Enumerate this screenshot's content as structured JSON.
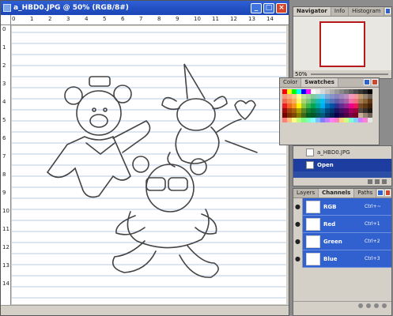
{
  "document": {
    "title": "a_HBD0.JPG @ 50% (RGB/8#)",
    "ruler_top": [
      "0",
      "1",
      "2",
      "3",
      "4",
      "5",
      "6",
      "7",
      "8",
      "9",
      "10",
      "11",
      "12",
      "13",
      "14"
    ],
    "ruler_left": [
      "0",
      "1",
      "2",
      "3",
      "4",
      "5",
      "6",
      "7",
      "8",
      "9",
      "10",
      "11",
      "12",
      "13",
      "14"
    ]
  },
  "navigator": {
    "tabs": [
      "Navigator",
      "Info",
      "Histogram"
    ],
    "zoom": "50%"
  },
  "swatches": {
    "tabs": [
      "Color",
      "Swatches"
    ],
    "colors": [
      "#ff0000",
      "#ffff00",
      "#00ff00",
      "#00ffff",
      "#0000ff",
      "#ff00ff",
      "#ffffff",
      "#ebebeb",
      "#d7d7d7",
      "#c3c3c3",
      "#afafaf",
      "#9b9b9b",
      "#878787",
      "#737373",
      "#5f5f5f",
      "#4b4b4b",
      "#373737",
      "#232323",
      "#000000",
      "#f7977a",
      "#f9ad81",
      "#fdc68a",
      "#fff79a",
      "#c4df9b",
      "#a2d39c",
      "#82ca9d",
      "#7bcdc8",
      "#6ecff6",
      "#7ea7d8",
      "#8493ca",
      "#8882be",
      "#a187be",
      "#bc8dbf",
      "#f49ac2",
      "#f6989d",
      "#c69c6d",
      "#998675",
      "#736357",
      "#f26c4f",
      "#f68e56",
      "#fbaf5d",
      "#fff467",
      "#acd372",
      "#7cc576",
      "#3bb878",
      "#1abbb4",
      "#00bff3",
      "#438ccb",
      "#5574b9",
      "#605ca8",
      "#855fa8",
      "#a763a8",
      "#f06ea9",
      "#f26d7d",
      "#a67c52",
      "#8c6239",
      "#603913",
      "#ed1c24",
      "#f26522",
      "#f7941d",
      "#fff200",
      "#8dc63f",
      "#39b54a",
      "#00a651",
      "#00a99d",
      "#00aeef",
      "#0072bc",
      "#0054a6",
      "#2e3192",
      "#662d91",
      "#92278f",
      "#ec008c",
      "#ed145b",
      "#754c24",
      "#603913",
      "#42210b",
      "#9e0b0f",
      "#a0410d",
      "#a3620a",
      "#aba000",
      "#598527",
      "#1a7b30",
      "#007236",
      "#00746b",
      "#0076a3",
      "#004a80",
      "#003471",
      "#1b1464",
      "#440e62",
      "#630460",
      "#9e005d",
      "#9e0039",
      "#534741",
      "#362f2d",
      "#1c1614",
      "#790000",
      "#7b2e00",
      "#7d4900",
      "#827b00",
      "#406618",
      "#005e20",
      "#005826",
      "#005952",
      "#005b7f",
      "#003663",
      "#002157",
      "#0d004c",
      "#32004b",
      "#4b0049",
      "#7b0046",
      "#7a0026",
      "#c7b299",
      "#998675",
      "#736357",
      "#ff7f7f",
      "#ffbf7f",
      "#ffff7f",
      "#bfff7f",
      "#7fff7f",
      "#7fffbf",
      "#7fffff",
      "#7fbfff",
      "#7f7fff",
      "#bf7fff",
      "#ff7fff",
      "#ff7fbf",
      "#ffd27f",
      "#d2ff7f",
      "#7fffd2",
      "#7fd2ff",
      "#d27fff",
      "#ff7fd2",
      "#e5e5e5"
    ]
  },
  "history": {
    "items": [
      {
        "label": "a_HBD0.JPG",
        "selected": false
      },
      {
        "label": "Open",
        "selected": true
      }
    ]
  },
  "layers": {
    "tabs": [
      "Layers",
      "Channels",
      "Paths"
    ],
    "channels": [
      {
        "name": "RGB",
        "shortcut": "Ctrl+~"
      },
      {
        "name": "Red",
        "shortcut": "Ctrl+1"
      },
      {
        "name": "Green",
        "shortcut": "Ctrl+2"
      },
      {
        "name": "Blue",
        "shortcut": "Ctrl+3"
      }
    ]
  }
}
